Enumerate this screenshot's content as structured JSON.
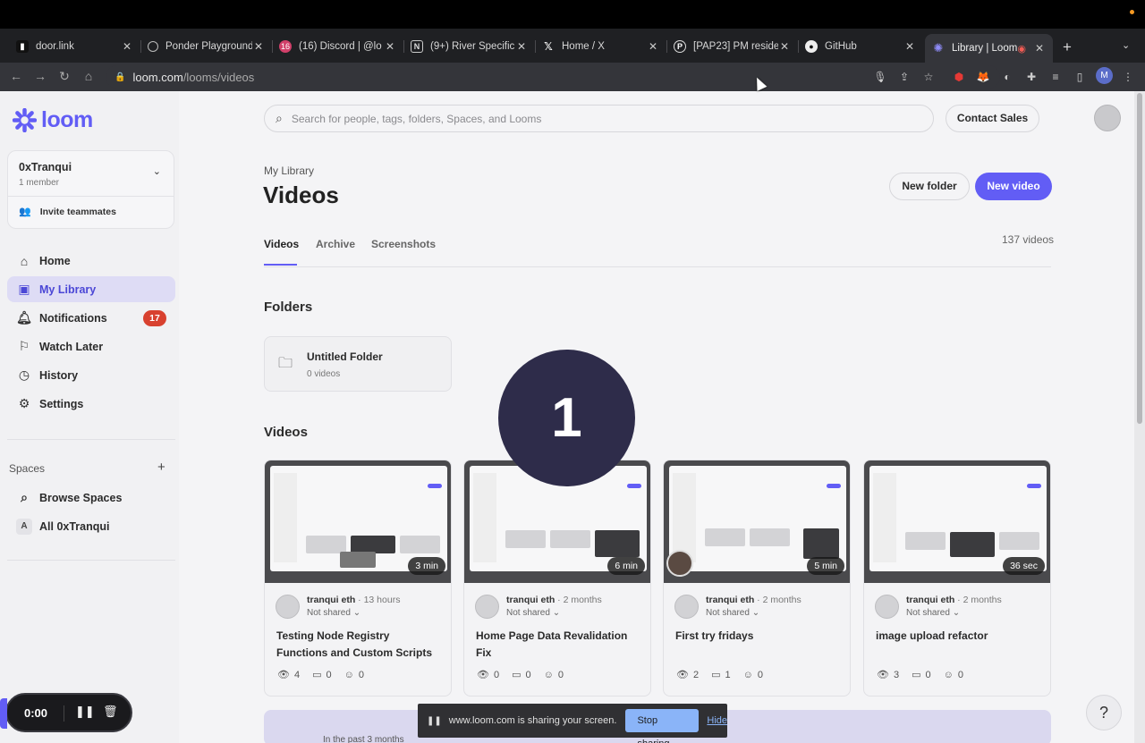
{
  "browser": {
    "tabs": [
      {
        "title": "door.link",
        "icon": "door-icon"
      },
      {
        "title": "Ponder Playground",
        "icon": "globe-icon"
      },
      {
        "title": "(16) Discord | @lo",
        "icon": "discord-icon"
      },
      {
        "title": "(9+) River Specific",
        "icon": "notion-icon"
      },
      {
        "title": "Home / X",
        "icon": "x-icon"
      },
      {
        "title": "[PAP23] PM reside",
        "icon": "p-icon"
      },
      {
        "title": "GitHub",
        "icon": "github-icon"
      },
      {
        "title": "Library | Loom",
        "icon": "loom-icon"
      }
    ],
    "new_tab": "+",
    "url_host": "loom.com",
    "url_path": "/looms/videos",
    "profile_initial": "M"
  },
  "sidebar": {
    "logo_text": "loom",
    "workspace": {
      "name": "0xTranqui",
      "members": "1 member",
      "invite_label": "Invite teammates"
    },
    "nav": [
      {
        "label": "Home",
        "icon": "home-icon"
      },
      {
        "label": "My Library",
        "icon": "library-icon"
      },
      {
        "label": "Notifications",
        "icon": "bell-icon",
        "badge": "17"
      },
      {
        "label": "Watch Later",
        "icon": "bookmark-icon"
      },
      {
        "label": "History",
        "icon": "clock-icon"
      },
      {
        "label": "Settings",
        "icon": "gear-icon"
      }
    ],
    "spaces_heading": "Spaces",
    "spaces": [
      {
        "label": "Browse Spaces",
        "icon": "search-icon"
      },
      {
        "label": "All 0xTranqui",
        "icon": "space-a-icon",
        "letter": "A"
      }
    ]
  },
  "header": {
    "search_placeholder": "Search for people, tags, folders, Spaces, and Looms",
    "contact_sales": "Contact Sales"
  },
  "library": {
    "breadcrumb": "My Library",
    "title": "Videos",
    "new_folder": "New folder",
    "new_video": "New video",
    "tabs": [
      "Videos",
      "Archive",
      "Screenshots"
    ],
    "video_count": "137 videos",
    "folders_heading": "Folders",
    "folder": {
      "name": "Untitled Folder",
      "count": "0 videos"
    },
    "videos_heading": "Videos",
    "videos": [
      {
        "duration": "3 min",
        "author": "tranqui eth",
        "time": "· 13 hours",
        "sharing": "Not shared ⌄",
        "title": "Testing Node Registry Functions and Custom Scripts",
        "views": "4",
        "comments": "0",
        "reactions": "0"
      },
      {
        "duration": "6 min",
        "author": "tranqui eth",
        "time": "· 2 months",
        "sharing": "Not shared ⌄",
        "title": "Home Page Data Revalidation Fix",
        "views": "0",
        "comments": "0",
        "reactions": "0"
      },
      {
        "duration": "5 min",
        "author": "tranqui eth",
        "time": "· 2 months",
        "sharing": "Not shared ⌄",
        "title": "First try fridays",
        "views": "2",
        "comments": "1",
        "reactions": "0"
      },
      {
        "duration": "36 sec",
        "author": "tranqui eth",
        "time": "· 2 months",
        "sharing": "Not shared ⌄",
        "title": "image upload refactor",
        "views": "3",
        "comments": "0",
        "reactions": "0"
      }
    ],
    "promo_text": "In the past 3 months"
  },
  "overlay": {
    "countdown": "1",
    "recording_time": "0:00",
    "share_message": "www.loom.com is sharing your screen.",
    "stop_sharing": "Stop sharing",
    "hide": "Hide",
    "help": "?"
  },
  "colors": {
    "brand": "#625df5",
    "badge": "#d8412f"
  }
}
